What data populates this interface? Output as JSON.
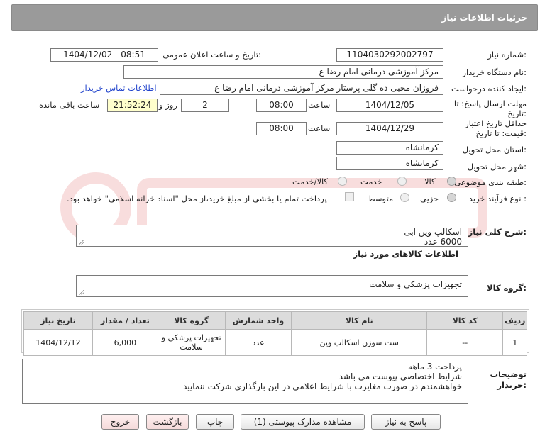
{
  "header": {
    "title": "جزئیات اطلاعات نیاز"
  },
  "fields": {
    "need_number_label": "شماره نیاز:",
    "need_number": "1104030292002797",
    "announce_label": "تاریخ و ساعت اعلان عمومی:",
    "announce_value": "1404/12/02 - 08:51",
    "buyer_org_label": "نام دستگاه خریدار:",
    "buyer_org": "مرکز آموزشی  درمانی امام رضا  ع",
    "requester_label": "ایجاد کننده درخواست:",
    "requester": "فروزان محبی ده گلی پرستار مرکز آموزشی  درمانی امام رضا  ع",
    "contact_link": "اطلاعات تماس خریدار",
    "deadline_label_1": "مهلت ارسال پاسخ: تا",
    "deadline_label_2": "تاریخ:",
    "deadline_date": "1404/12/05",
    "time_label": "ساعت",
    "deadline_time": "08:00",
    "days_value": "2",
    "days_label": "روز و",
    "remaining_time": "21:52:24",
    "remaining_label": "ساعت باقی مانده",
    "validity_label_1": "حداقل تاریخ اعتبار",
    "validity_label_2": "قیمت: تا تاریخ:",
    "validity_date": "1404/12/29",
    "validity_time_label": "ساعت",
    "validity_time": "08:00",
    "province_label": "استان محل تحویل:",
    "province": "کرمانشاه",
    "city_label": "شهر محل تحویل:",
    "city": "کرمانشاه",
    "category_label": "طبقه بندی موضوعی:",
    "category_options": [
      "کالا",
      "خدمت",
      "کالا/خدمت"
    ],
    "process_label": "نوع فرآیند خرید :",
    "process_options": [
      "جزیی",
      "متوسط"
    ],
    "treasury_note": "پرداخت تمام یا بخشی از مبلغ خرید،از محل \"اسناد خزانه اسلامی\" خواهد بود."
  },
  "description": {
    "label": "شرح کلی نیاز:",
    "text_line1": "اسکالپ وین ابی",
    "text_line2": "6000 عدد"
  },
  "goods": {
    "section_title": "اطلاعات کالاهای مورد نیاز",
    "group_label": "گروه کالا:",
    "group_value": "تجهیزات پزشکی و سلامت",
    "columns": [
      "ردیف",
      "کد کالا",
      "نام کالا",
      "واحد شمارش",
      "گروه کالا",
      "تعداد / مقدار",
      "تاریخ نیاز"
    ],
    "rows": [
      {
        "row": "1",
        "code": "--",
        "name": "ست سوزن اسکالپ وین",
        "unit": "عدد",
        "group": "تجهیزات پزشکی و سلامت",
        "qty": "6,000",
        "date": "1404/12/12"
      }
    ]
  },
  "buyer_notes": {
    "label_1": "توضیحات",
    "label_2": "خریدار:",
    "line1": "پرداخت 3 ماهه",
    "line2": "شرایط اختصاصی پیوست می باشد",
    "line3": "خواهشمندم  در صورت مغایرت با شرایط اعلامی در این بارگذاری شرکت ننمایید"
  },
  "buttons": {
    "reply": "پاسخ به نیاز",
    "view_docs": "مشاهده مدارک پیوستی (1)",
    "print": "چاپ",
    "back": "بازگشت",
    "exit": "خروج"
  },
  "colors": {
    "header_bg": "#9a9a9a",
    "link": "#2244cc",
    "yellow_field": "#ffffcc"
  }
}
